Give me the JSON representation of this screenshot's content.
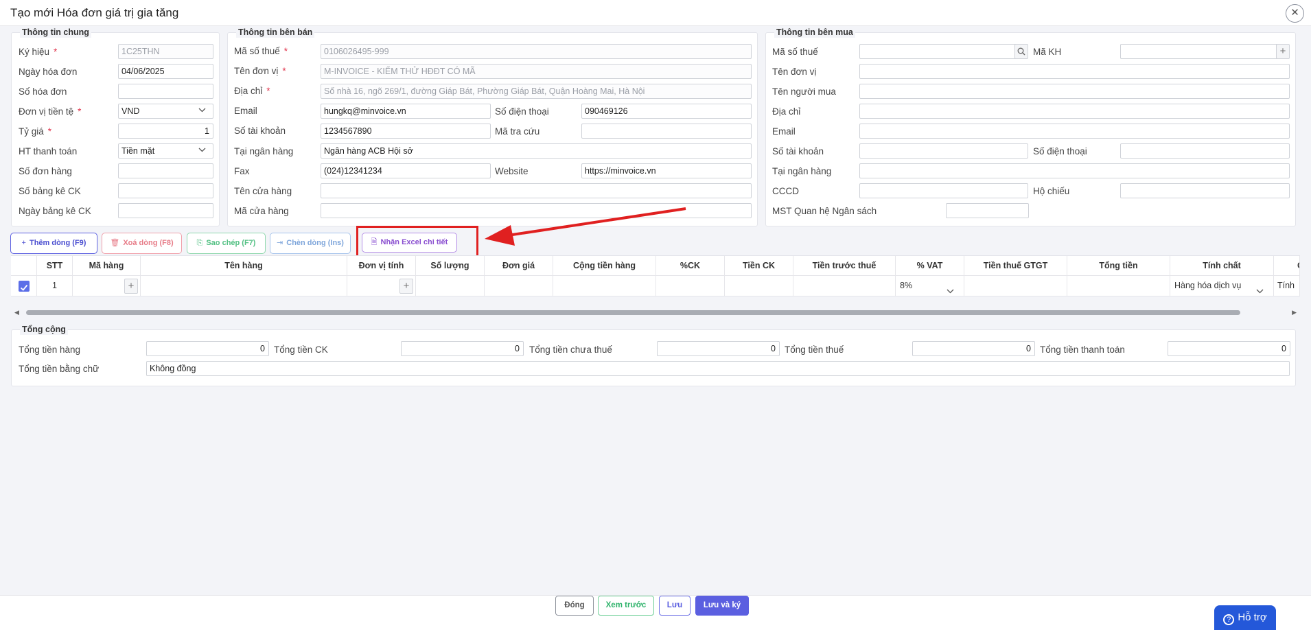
{
  "dialog": {
    "title": "Tạo mới Hóa đơn giá trị gia tăng",
    "close_icon": "close-icon"
  },
  "general": {
    "legend": "Thông tin chung",
    "fields": [
      {
        "label": "Ký hiệu",
        "required": true,
        "value": "1C25THN",
        "disabled": true
      },
      {
        "label": "Ngày hóa đơn",
        "required": false,
        "value": "04/06/2025"
      },
      {
        "label": "Số hóa đơn",
        "required": false,
        "value": ""
      },
      {
        "label": "Đơn vị tiền tệ",
        "required": true,
        "value": "VND",
        "select": true
      },
      {
        "label": "Tỷ giá",
        "required": true,
        "value": "1",
        "align": "right"
      },
      {
        "label": "HT thanh toán",
        "required": false,
        "value": "Tiền mặt",
        "select": true
      },
      {
        "label": "Số đơn hàng",
        "required": false,
        "value": ""
      },
      {
        "label": "Số bảng kê CK",
        "required": false,
        "value": ""
      },
      {
        "label": "Ngày bảng kê CK",
        "required": false,
        "value": ""
      }
    ]
  },
  "seller": {
    "legend": "Thông tin bên bán",
    "tax_code": {
      "label": "Mã số thuế",
      "value": "0106026495-999"
    },
    "name": {
      "label": "Tên đơn vị",
      "value": "M-INVOICE - KIỂM THỬ HĐĐT CÓ MÃ"
    },
    "address": {
      "label": "Địa chỉ",
      "value": "Số nhà 16, ngõ 269/1, đường Giáp Bát, Phường Giáp Bát, Quận Hoàng Mai, Hà Nội"
    },
    "email": {
      "label": "Email",
      "value": "hungkq@minvoice.vn"
    },
    "phone": {
      "label": "Số điện thoại",
      "value": "090469126"
    },
    "account": {
      "label": "Số tài khoản",
      "value": "1234567890"
    },
    "lookup": {
      "label": "Mã tra cứu",
      "value": ""
    },
    "bank": {
      "label": "Tại ngân hàng",
      "value": "Ngân hàng ACB Hội sở"
    },
    "fax": {
      "label": "Fax",
      "value": "(024)12341234"
    },
    "website": {
      "label": "Website",
      "value": "https://minvoice.vn"
    },
    "store_name": {
      "label": "Tên cửa hàng",
      "value": ""
    },
    "store_code": {
      "label": "Mã cửa hàng",
      "value": ""
    }
  },
  "buyer": {
    "legend": "Thông tin bên mua",
    "tax_code": {
      "label": "Mã số thuế",
      "value": ""
    },
    "customer_code": {
      "label": "Mã KH",
      "value": ""
    },
    "unit_name": {
      "label": "Tên đơn vị",
      "value": ""
    },
    "buyer_name": {
      "label": "Tên người mua",
      "value": ""
    },
    "address": {
      "label": "Địa chỉ",
      "value": ""
    },
    "email": {
      "label": "Email",
      "value": ""
    },
    "account": {
      "label": "Số tài khoản",
      "value": ""
    },
    "phone": {
      "label": "Số điện thoại",
      "value": ""
    },
    "bank": {
      "label": "Tại ngân hàng",
      "value": ""
    },
    "id_card": {
      "label": "CCCD",
      "value": ""
    },
    "passport": {
      "label": "Hộ chiếu",
      "value": ""
    },
    "budget_code": {
      "label": "MST Quan hệ Ngân sách",
      "value": ""
    }
  },
  "toolbar": {
    "add_row": "Thêm dòng (F9)",
    "delete_row": "Xoá dòng (F8)",
    "copy": "Sao chép (F7)",
    "insert_row": "Chèn dòng (Ins)",
    "import_excel": "Nhận Excel chi tiết"
  },
  "table": {
    "columns": [
      "STT",
      "Mã hàng",
      "Tên hàng",
      "Đơn vị tính",
      "Số lượng",
      "Đơn giá",
      "Cộng tiền hàng",
      "%CK",
      "Tiền CK",
      "Tiền trước thuế",
      "% VAT",
      "Tiền thuế GTGT",
      "Tổng tiền",
      "Tính chất",
      "G"
    ],
    "rows": [
      {
        "checked": true,
        "stt": "1",
        "vat": "8%",
        "nature": "Hàng hóa dịch vụ",
        "extra": "Tính"
      }
    ]
  },
  "totals": {
    "legend": "Tổng cộng",
    "items": [
      {
        "label": "Tổng tiền hàng",
        "value": "0"
      },
      {
        "label": "Tổng tiền CK",
        "value": "0"
      },
      {
        "label": "Tổng tiền chưa thuế",
        "value": "0"
      },
      {
        "label": "Tổng tiền thuế",
        "value": "0"
      },
      {
        "label": "Tổng tiền thanh toán",
        "value": "0"
      }
    ],
    "in_words": {
      "label": "Tổng tiền bằng chữ",
      "value": "Không đồng"
    }
  },
  "footer": {
    "close": "Đóng",
    "preview": "Xem trước",
    "save": "Lưu",
    "save_sign": "Lưu và ký"
  },
  "help": {
    "label": "Hỗ trợ"
  },
  "colors": {
    "primary": "#5b5fe0",
    "danger": "#e0334b",
    "success": "#2fb36b",
    "highlight": "#e02020",
    "excel": "#8a4fd0"
  }
}
